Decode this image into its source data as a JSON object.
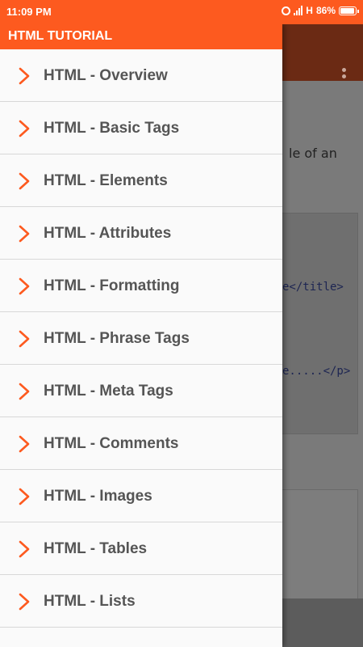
{
  "status_bar": {
    "time": "11:09 PM",
    "network_type": "H",
    "battery_percent": "86%",
    "icons": [
      "alarm-icon",
      "signal-icon",
      "battery-icon"
    ]
  },
  "drawer": {
    "title": "HTML TUTORIAL",
    "items": [
      {
        "label": "HTML - Overview"
      },
      {
        "label": "HTML - Basic Tags"
      },
      {
        "label": "HTML - Elements"
      },
      {
        "label": "HTML - Attributes"
      },
      {
        "label": "HTML - Formatting"
      },
      {
        "label": "HTML - Phrase Tags"
      },
      {
        "label": "HTML - Meta Tags"
      },
      {
        "label": "HTML - Comments"
      },
      {
        "label": "HTML - Images"
      },
      {
        "label": "HTML - Tables"
      },
      {
        "label": "HTML - Lists"
      }
    ]
  },
  "background": {
    "text_fragment": "le of an",
    "code_lines": [
      "e</title>",
      "e.....</p>"
    ]
  },
  "colors": {
    "accent": "#fd5a1f",
    "drawer_bg": "#fafafa",
    "item_text": "#555555"
  }
}
